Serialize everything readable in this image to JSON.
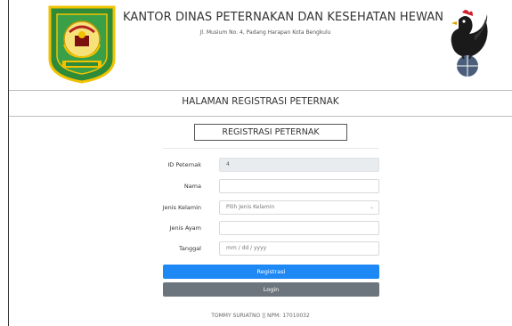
{
  "header": {
    "title": "KANTOR DINAS PETERNAKAN DAN KESEHATAN HEWAN",
    "address": "Jl. Musium No. 4, Padang Harapan Kota Bengkulu",
    "logo_left_icon": "provincial-emblem-icon",
    "logo_right_icon": "rooster-icon"
  },
  "page": {
    "heading": "HALAMAN REGISTRASI PETERNAK"
  },
  "form": {
    "title": "REGISTRASI PETERNAK",
    "fields": {
      "id": {
        "label": "ID Peternak",
        "value": "4"
      },
      "nama": {
        "label": "Nama",
        "value": ""
      },
      "jenis_kelamin": {
        "label": "Jenis Kelamin",
        "value": "Pilih Jenis Kelamin"
      },
      "jenis_ayam": {
        "label": "Jenis Ayam",
        "value": ""
      },
      "tanggal": {
        "label": "Tanggal",
        "placeholder": "mm / dd / yyyy"
      }
    },
    "submit_label": "Registrasi",
    "login_label": "Login"
  },
  "footer": {
    "text": "TOMMY SURIATNO || NPM: 17010032"
  },
  "colors": {
    "primary": "#1e88f5",
    "secondary": "#6c757d",
    "emblem_green": "#2e8b3a",
    "emblem_yellow": "#f2c200"
  }
}
